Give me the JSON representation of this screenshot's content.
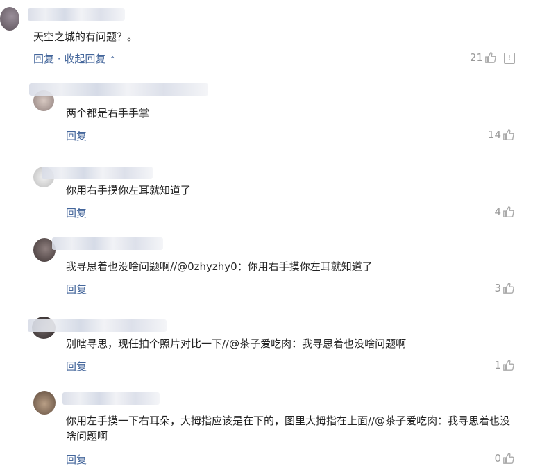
{
  "comments": [
    {
      "text": "天空之城的有问题？。",
      "reply": "回复",
      "collapse": "· 收起回复",
      "likes": "21"
    },
    {
      "text": "两个都是右手手掌",
      "reply": "回复",
      "likes": "14"
    },
    {
      "text": "你用右手摸你左耳就知道了",
      "reply": "回复",
      "likes": "4"
    },
    {
      "text": "我寻思着也没啥问题啊//@0zhyzhy0：你用右手摸你左耳就知道了",
      "reply": "回复",
      "likes": "3"
    },
    {
      "text": "别瞎寻思，现任拍个照片对比一下//@茶子爱吃肉：我寻思着也没啥问题啊",
      "reply": "回复",
      "likes": "1"
    },
    {
      "text": "你用左手摸一下右耳朵，大拇指应该是在下的，图里大拇指在上面//@茶子爱吃肉：我寻思着也没啥问题啊",
      "reply": "回复",
      "likes": "0"
    }
  ],
  "icons": {
    "like": "thumbs-up-icon",
    "report": "report-icon",
    "collapse": "chevron-up-icon"
  },
  "colors": {
    "link": "#44669b",
    "muted": "#999999"
  }
}
